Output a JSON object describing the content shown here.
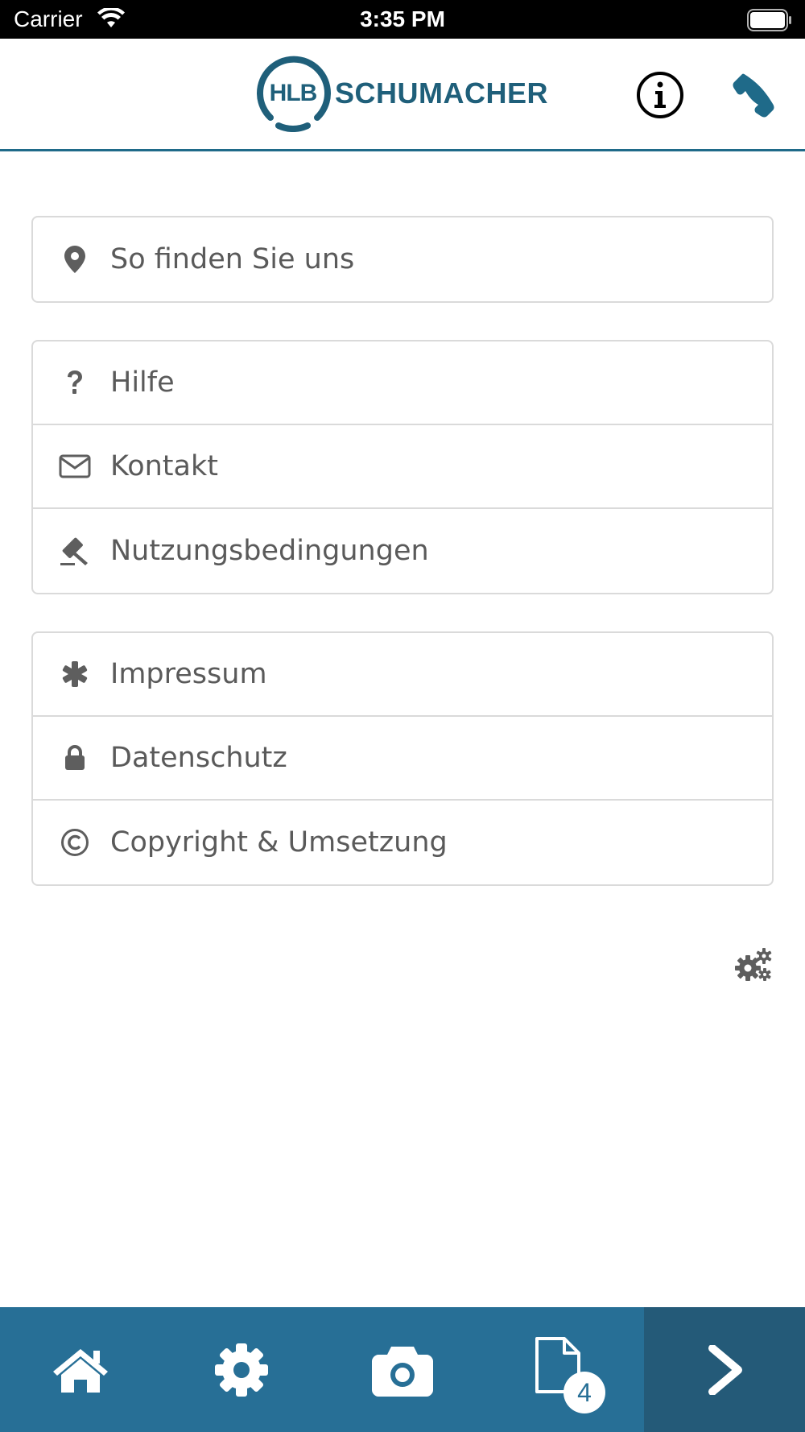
{
  "status_bar": {
    "carrier": "Carrier",
    "time": "3:35 PM"
  },
  "header": {
    "logo_mark": "HLB",
    "logo_name": "SCHUMACHER",
    "brand_color": "#1f5f7a",
    "info_icon": "info-icon",
    "phone_icon": "phone-icon"
  },
  "menu": {
    "group1": [
      {
        "icon": "map-marker-icon",
        "label": "So finden Sie uns"
      }
    ],
    "group2": [
      {
        "icon": "question-icon",
        "label": "Hilfe"
      },
      {
        "icon": "envelope-icon",
        "label": "Kontakt"
      },
      {
        "icon": "gavel-icon",
        "label": "Nutzungsbedingungen"
      }
    ],
    "group3": [
      {
        "icon": "asterisk-icon",
        "label": "Impressum"
      },
      {
        "icon": "lock-icon",
        "label": "Datenschutz"
      },
      {
        "icon": "copyright-icon",
        "label": "Copyright & Umsetzung"
      }
    ]
  },
  "tabbar": {
    "color": "#276f96",
    "tabs": [
      "home-icon",
      "settings-icon",
      "camera-icon",
      "document-icon",
      "chevron-right-icon"
    ],
    "document_badge": "4"
  }
}
